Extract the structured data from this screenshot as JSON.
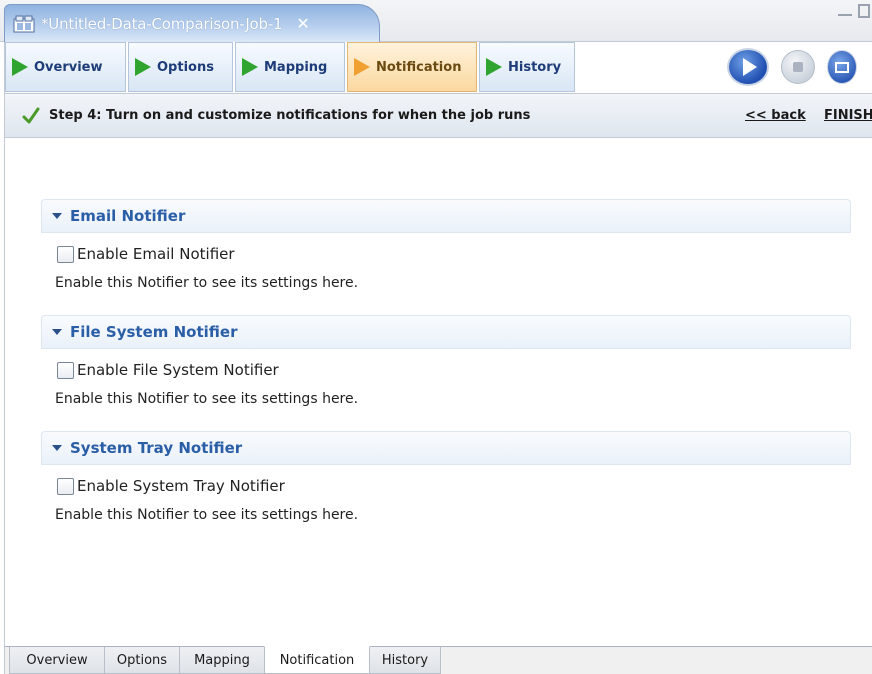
{
  "editor_tab": {
    "title": "*Untitled-Data-Comparison-Job-1",
    "icon": "job-icon",
    "close_label": "✕"
  },
  "wizard_nav": {
    "items": [
      {
        "label": "Overview",
        "icon": "arrow-right-icon",
        "state": "done"
      },
      {
        "label": "Options",
        "icon": "arrow-right-icon",
        "state": "done"
      },
      {
        "label": "Mapping",
        "icon": "arrow-right-icon",
        "state": "done"
      },
      {
        "label": "Notification",
        "icon": "arrow-right-icon",
        "state": "active"
      },
      {
        "label": "History",
        "icon": "arrow-right-icon",
        "state": "done"
      }
    ],
    "controls": [
      "play-icon",
      "stop-icon",
      "console-icon"
    ]
  },
  "step": {
    "text": "Step 4: Turn on and customize notifications for when the job runs",
    "back_label": "<< back",
    "finish_label": "FINISH"
  },
  "sections": [
    {
      "title": "Email Notifier",
      "checkbox_label": "Enable Email Notifier",
      "checked": false,
      "hint": "Enable this Notifier to see its settings here."
    },
    {
      "title": "File System Notifier",
      "checkbox_label": "Enable File System Notifier",
      "checked": false,
      "hint": "Enable this Notifier to see its settings here."
    },
    {
      "title": "System Tray Notifier",
      "checkbox_label": "Enable System Tray Notifier",
      "checked": false,
      "hint": "Enable this Notifier to see its settings here."
    }
  ],
  "bottom_tabs": [
    {
      "label": "Overview",
      "active": false
    },
    {
      "label": "Options",
      "active": false
    },
    {
      "label": "Mapping",
      "active": false
    },
    {
      "label": "Notification",
      "active": true
    },
    {
      "label": "History",
      "active": false
    }
  ],
  "colors": {
    "done_arrow": "#2fa42f",
    "active_arrow": "#f0a030",
    "section_title": "#2a5ea6"
  }
}
